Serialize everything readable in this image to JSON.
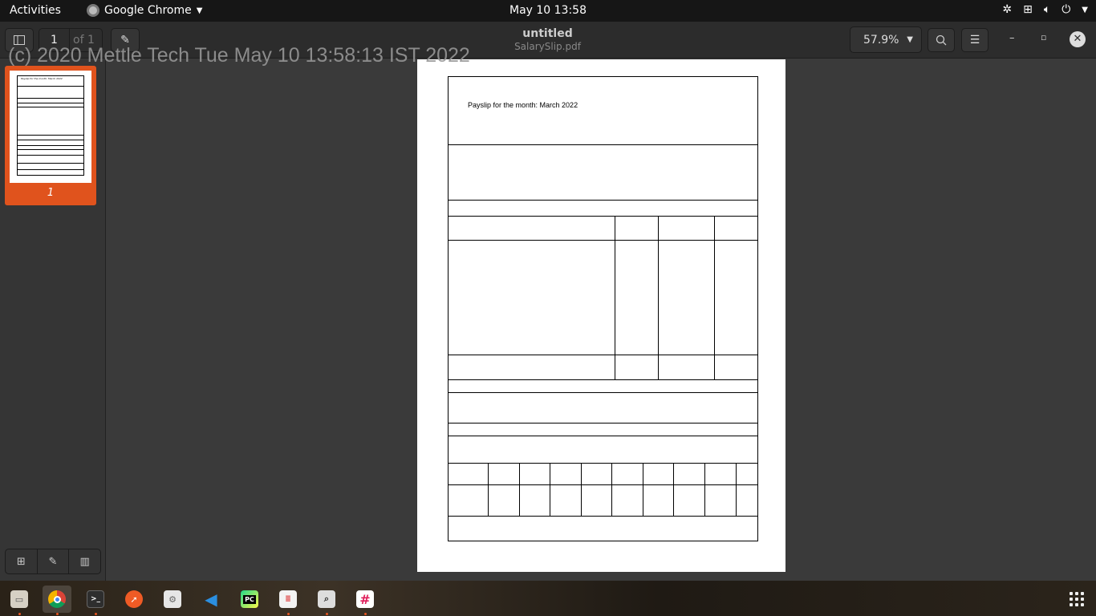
{
  "topbar": {
    "activities": "Activities",
    "app_name": "Google Chrome",
    "clock": "May 10  13:58"
  },
  "viewer": {
    "page_current": "1",
    "page_of": "of 1",
    "title": "untitled",
    "subtitle": "SalarySlip.pdf",
    "zoom": "57.9%",
    "thumb_page_number": "1"
  },
  "watermark": "(c) 2020 Mettle Tech Tue May 10 13:58:13 IST 2022",
  "document": {
    "heading": "Payslip for the month: March 2022"
  },
  "dock": {
    "apps": [
      "files",
      "google-chrome",
      "terminal",
      "postman",
      "settings",
      "vscode",
      "pycharm",
      "document-viewer",
      "image-viewer",
      "slack"
    ]
  },
  "colors": {
    "accent": "#e0531d",
    "topbar": "#161616",
    "headerbar": "#2c2c2c",
    "background": "#3a3a3a"
  }
}
